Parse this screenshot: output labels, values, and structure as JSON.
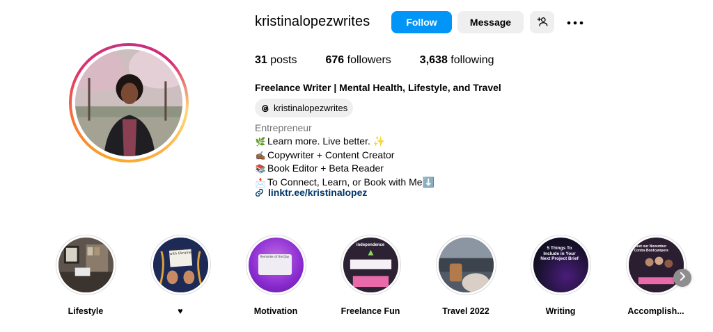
{
  "profile": {
    "username": "kristinalopezwrites",
    "follow_label": "Follow",
    "message_label": "Message",
    "add_user_icon": "add-user-icon",
    "more_icon": "more-options-icon",
    "stats": {
      "posts_count": "31",
      "posts_label": "posts",
      "followers_count": "676",
      "followers_label": "followers",
      "following_count": "3,638",
      "following_label": "following"
    },
    "full_name": "Freelance Writer | Mental Health, Lifestyle, and Travel",
    "threads_handle": "kristinalopezwrites",
    "category": "Entrepreneur",
    "bio": [
      {
        "emoji": "🌿",
        "text": "Learn more. Live better. ✨"
      },
      {
        "emoji": "✍🏾",
        "text": "Copywriter + Content Creator"
      },
      {
        "emoji": "📚",
        "text": "Book Editor + Beta Reader"
      },
      {
        "emoji": "📩",
        "text": "To Connect, Learn, or Book with Me⬇️"
      }
    ],
    "link": "linktr.ee/kristinalopez"
  },
  "highlights": [
    {
      "label": "Lifestyle",
      "thumb_text": ""
    },
    {
      "label": "♥",
      "thumb_text": "We Stand with Ukraine"
    },
    {
      "label": "Motivation",
      "thumb_text": "Reminder of the Day"
    },
    {
      "label": "Freelance Fun",
      "thumb_text": "independence"
    },
    {
      "label": "Travel 2022",
      "thumb_text": ""
    },
    {
      "label": "Writing",
      "thumb_text": "5 Things To Include in Your Next Project Brief"
    },
    {
      "label": "Accomplish...",
      "thumb_text": "Meet our November Contra Bootcampers"
    }
  ],
  "colors": {
    "follow_button": "#0095f6",
    "secondary_button": "#efefef",
    "link": "#00376b",
    "muted_text": "#737373"
  }
}
